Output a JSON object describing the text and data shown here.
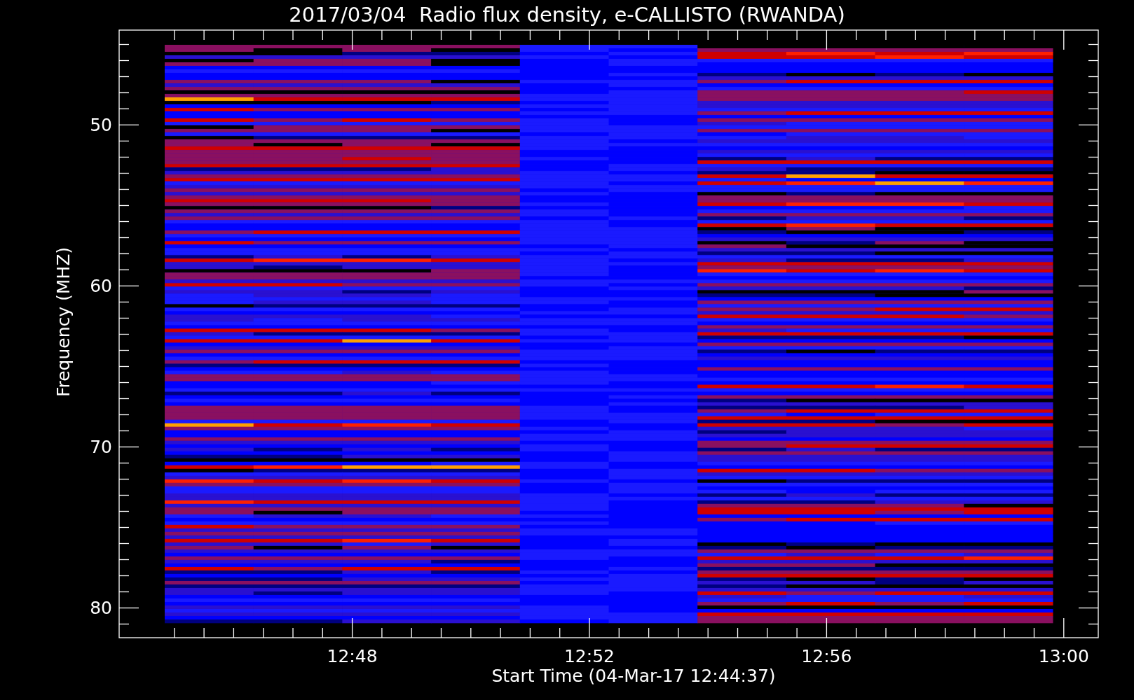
{
  "title": "2017/03/04  Radio flux density, e-CALLISTO (RWANDA)",
  "y_axis": {
    "label": "Frequency (MHZ)",
    "ticks": [
      "50",
      "60",
      "70",
      "80"
    ]
  },
  "x_axis": {
    "label": "Start Time (04-Mar-17 12:44:37)",
    "ticks": [
      "12:48",
      "12:52",
      "12:56",
      "13:00"
    ]
  }
}
